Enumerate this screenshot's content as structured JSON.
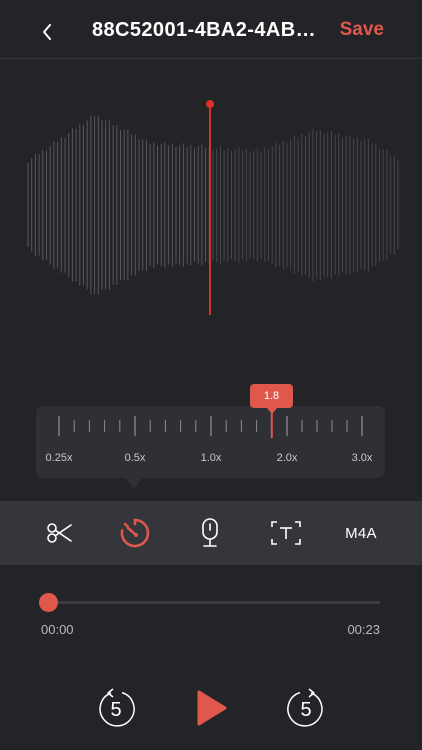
{
  "header": {
    "title": "88C52001-4BA2-4AB…",
    "save_label": "Save",
    "back_icon": "chevron-left-icon"
  },
  "speed": {
    "current": "1.8",
    "current_value": 1.8,
    "labels": [
      "0.25x",
      "0.5x",
      "1.0x",
      "2.0x",
      "3.0x"
    ]
  },
  "toolbar": {
    "items": [
      {
        "icon": "scissors-icon"
      },
      {
        "icon": "speed-timer-icon",
        "active": true
      },
      {
        "icon": "microphone-icon"
      },
      {
        "icon": "text-frame-icon"
      },
      {
        "label": "M4A"
      }
    ]
  },
  "playback": {
    "current_time": "00:00",
    "total_time": "00:23",
    "progress": 0,
    "skip_back": "5",
    "skip_forward": "5"
  },
  "colors": {
    "accent": "#e0584b",
    "background": "#222428",
    "toolbar": "#34363b"
  }
}
